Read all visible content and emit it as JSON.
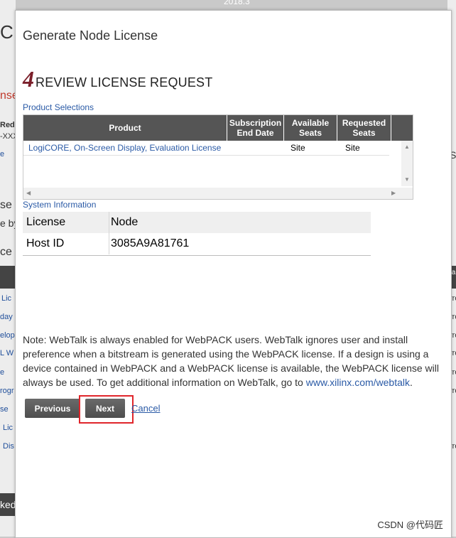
{
  "background_fragments": {
    "top_center": "2018.3",
    "left_items": [
      "C",
      "nse",
      "Red",
      "-XXX",
      "e",
      "se",
      "e by",
      "ce",
      "Lic",
      "day",
      "elop",
      "L W",
      "e",
      "rogr",
      "se",
      "Lic",
      "Dis",
      "ked"
    ],
    "right_items": [
      "S",
      "ta",
      "rro",
      "rro",
      "rro",
      "rro",
      "rro",
      "rro",
      "rro"
    ]
  },
  "modal": {
    "title": "Generate Node License",
    "step_number": "4",
    "step_title": "REVIEW LICENSE REQUEST",
    "product_selections_label": "Product Selections",
    "product_table": {
      "headers": [
        "Product",
        "Subscription End Date",
        "Available Seats",
        "Requested Seats"
      ],
      "rows": [
        {
          "product": "LogiCORE, On-Screen Display, Evaluation License",
          "end_date": "",
          "available": "Site",
          "requested": "Site"
        }
      ]
    },
    "system_info_label": "System Information",
    "system_info": [
      {
        "label": "License",
        "value": "Node"
      },
      {
        "label": "Host ID",
        "value": "3085A9A81761"
      }
    ],
    "note_text": "Note: WebTalk is always enabled for WebPACK users. WebTalk ignores user and install preference when a bitstream is generated using the WebPACK license. If a design is using a device contained in WebPACK and a WebPACK license is available, the WebPACK license will always be used. To get additional information on WebTalk, go to ",
    "note_link": "www.xilinx.com/webtalk",
    "note_end": ".",
    "buttons": {
      "previous": "Previous",
      "next": "Next",
      "cancel": "Cancel"
    }
  },
  "watermark": "CSDN @代码匠",
  "colors": {
    "accent_link": "#2a5aa6",
    "step_number": "#7b1f2a",
    "table_header": "#555555",
    "highlight": "#e0252b"
  }
}
